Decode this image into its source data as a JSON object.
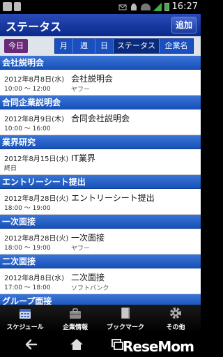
{
  "status_bar": {
    "time": "16:27",
    "icons": [
      "image-icon",
      "document-icon",
      "mail-icon",
      "android-icon",
      "wifi-icon",
      "signal-icon",
      "battery-icon"
    ]
  },
  "header": {
    "title": "ステータス",
    "add_label": "追加"
  },
  "filter": {
    "today_label": "今日",
    "tabs": [
      {
        "label": "月"
      },
      {
        "label": "週"
      },
      {
        "label": "日"
      },
      {
        "label": "ステータス",
        "active": true
      },
      {
        "label": "企業名"
      }
    ]
  },
  "sections": [
    {
      "title": "会社説明会",
      "item": {
        "date": "2012年8月8日(水)",
        "time": "10:00 ～ 12:00",
        "name": "会社説明会",
        "sub": "ヤフー"
      }
    },
    {
      "title": "合同企業説明会",
      "item": {
        "date": "2012年8月9日(木)",
        "time": "10:00 ～ 16:00",
        "name": "合同会社説明会",
        "sub": ""
      }
    },
    {
      "title": "業界研究",
      "item": {
        "date": "2012年8月15日(水)",
        "time": "終日",
        "name": "IT業界",
        "sub": ""
      }
    },
    {
      "title": "エントリーシート提出",
      "item": {
        "date": "2012年8月28日(火)",
        "time": "18:00 ～ 19:00",
        "name": "エントリーシート提出",
        "sub": ""
      }
    },
    {
      "title": "一次面接",
      "item": {
        "date": "2012年8月28日(火)",
        "time": "18:00 ～ 19:00",
        "name": "一次面接",
        "sub": "ヤフー"
      }
    },
    {
      "title": "二次面接",
      "item": {
        "date": "2012年8月8日(水)",
        "time": "17:00 ～ 18:00",
        "name": "二次面接",
        "sub": "ソフトバンク"
      }
    },
    {
      "title": "グループ面接"
    }
  ],
  "toolbar": {
    "items": [
      {
        "label": "スケジュール",
        "icon": "calendar-icon"
      },
      {
        "label": "企業情報",
        "icon": "briefcase-icon"
      },
      {
        "label": "ブックマーク",
        "icon": "book-icon"
      },
      {
        "label": "その他",
        "icon": "gear-icon"
      }
    ]
  },
  "nav": {
    "logo": "ReseMom"
  },
  "colors": {
    "header": "#0a2a8c",
    "section": "#1852b8",
    "today": "#6a2a7a"
  }
}
